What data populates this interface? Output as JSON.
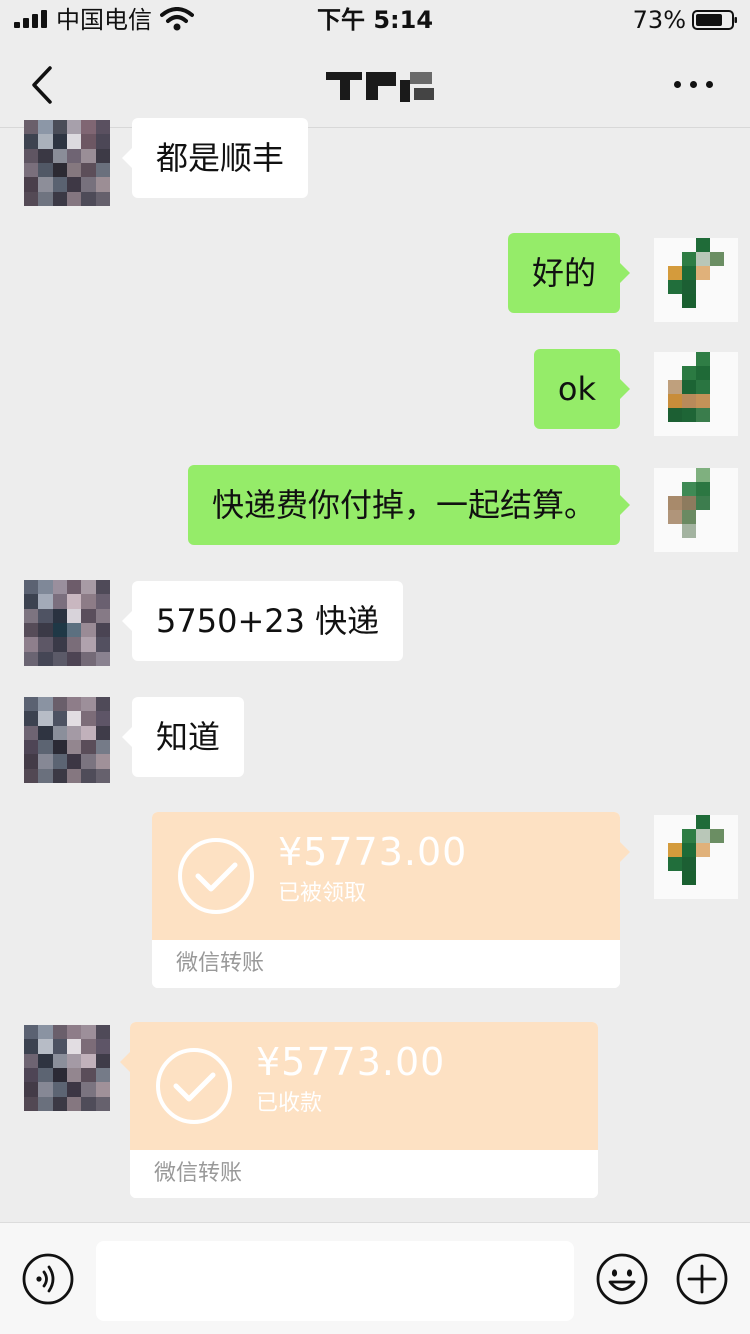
{
  "status_bar": {
    "carrier": "中国电信",
    "time": "下午 5:14",
    "battery": "73%"
  },
  "nav": {
    "back_icon": "chevron-left-icon",
    "more_icon": "ellipsis-icon"
  },
  "messages": [
    {
      "side": "left",
      "text": "都是顺丰"
    },
    {
      "side": "right",
      "text": "好的"
    },
    {
      "side": "right",
      "text": "ok"
    },
    {
      "side": "right",
      "text": "快递费你付掉，一起结算。"
    },
    {
      "side": "left",
      "text": "5750+23 快递"
    },
    {
      "side": "left",
      "text": "知道"
    }
  ],
  "transfers": [
    {
      "side": "right",
      "amount": "¥5773.00",
      "status": "已被领取",
      "footer": "微信转账"
    },
    {
      "side": "left",
      "amount": "¥5773.00",
      "status": "已收款",
      "footer": "微信转账"
    }
  ],
  "input_bar": {
    "voice_icon": "voice-icon",
    "emoji_icon": "emoji-icon",
    "plus_icon": "plus-icon"
  },
  "colors": {
    "background": "#ededed",
    "bubble_self": "#95ec69",
    "bubble_other": "#ffffff",
    "transfer": "#fde1c3"
  }
}
